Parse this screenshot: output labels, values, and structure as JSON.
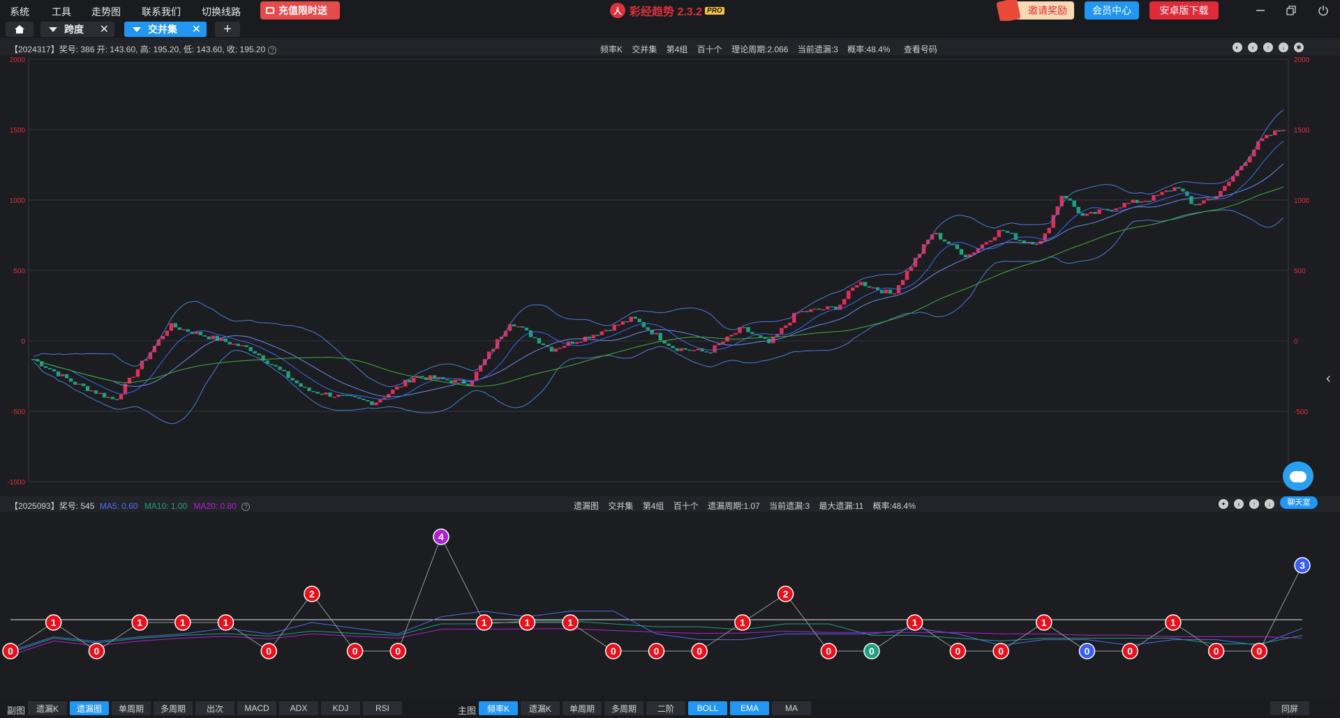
{
  "menu": {
    "items": [
      "系统",
      "工具",
      "走势图",
      "联系我们",
      "切换线路"
    ],
    "promo_label": "充值限时送",
    "app_name": "彩经趋势 2.3.2",
    "app_badge": "PRO",
    "logo_text": "人",
    "invite_label": "邀请奖励",
    "vip_label": "会员中心",
    "android_label": "安卓版下载"
  },
  "tabs": {
    "items": [
      {
        "label": "跨度",
        "active": false
      },
      {
        "label": "交并集",
        "active": true
      }
    ],
    "add_label": "+"
  },
  "main_chart": {
    "info_left": "【2024317】奖号: 386  开: 143.60, 高: 195.20, 低: 143.60, 收: 195.20",
    "info_center": [
      "频率K",
      "交并集",
      "第4组",
      "百十个",
      "理论周期:2.066",
      "当前遗漏:3",
      "概率:48.4%",
      "查看号码"
    ],
    "y_ticks": [
      "2000",
      "1500",
      "1000",
      "500",
      "0",
      "-500",
      "-1000"
    ],
    "y_tick_values": [
      2000,
      1500,
      1000,
      500,
      0,
      -500,
      -1000
    ],
    "y_range": [
      -1000,
      2000
    ],
    "up_color": "#e0305a",
    "down_color": "#20a080"
  },
  "sub_chart": {
    "info_left_prefix": "【2025093】奖号: 545",
    "ma5": "MA5: 0.60",
    "ma10": "MA10: 1.00",
    "ma20": "MA20: 0.80",
    "ma5_color": "#4c6ff0",
    "ma10_color": "#20a080",
    "ma20_color": "#b020d0",
    "info_center": [
      "遗漏图",
      "交并集",
      "第4组",
      "百十个",
      "遗漏周期:1.07",
      "当前遗漏:3",
      "最大遗漏:11",
      "概率:48.4%"
    ],
    "omission_values": [
      0,
      1,
      0,
      1,
      1,
      1,
      0,
      2,
      0,
      0,
      4,
      1,
      1,
      1,
      0,
      0,
      0,
      1,
      2,
      0,
      0,
      1,
      0,
      0,
      1,
      0,
      0,
      1,
      0,
      0,
      3
    ],
    "node_colors": {
      "default": "#e8101a",
      "special": [
        {
          "index": 10,
          "color": "#b020d0"
        },
        {
          "index": 20,
          "color": "#20a080"
        },
        {
          "index": 25,
          "color": "#3a5ef0"
        },
        {
          "index": 30,
          "color": "#3a5ef0"
        }
      ]
    }
  },
  "chat": {
    "label": "聊天室"
  },
  "toolbar": {
    "sub_label": "副图",
    "sub_buttons": [
      {
        "label": "遗漏K",
        "active": false
      },
      {
        "label": "遗漏图",
        "active": true
      },
      {
        "label": "单周期",
        "active": false
      },
      {
        "label": "多周期",
        "active": false
      },
      {
        "label": "出次",
        "active": false
      },
      {
        "label": "MACD",
        "active": false
      },
      {
        "label": "ADX",
        "active": false
      },
      {
        "label": "KDJ",
        "active": false
      },
      {
        "label": "RSI",
        "active": false
      }
    ],
    "main_label": "主图",
    "main_buttons": [
      {
        "label": "频率K",
        "active": true
      },
      {
        "label": "遗漏K",
        "active": false
      },
      {
        "label": "单周期",
        "active": false
      },
      {
        "label": "多周期",
        "active": false
      },
      {
        "label": "二阶",
        "active": false
      },
      {
        "label": "BOLL",
        "active": true
      },
      {
        "label": "EMA",
        "active": true
      },
      {
        "label": "MA",
        "active": false
      }
    ],
    "sync_label": "同屏"
  }
}
